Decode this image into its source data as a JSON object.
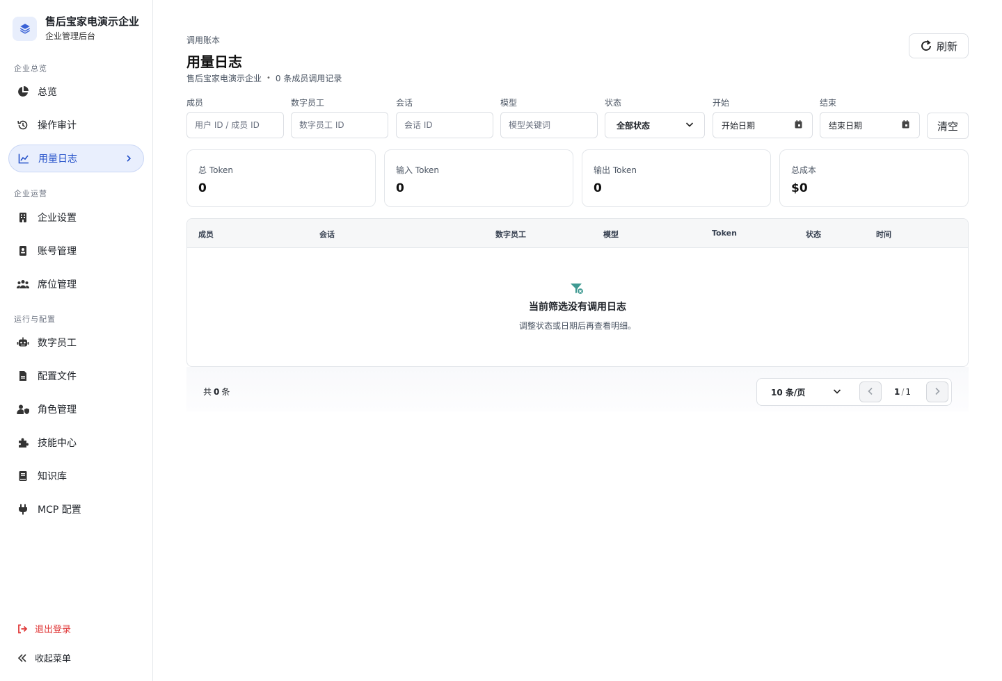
{
  "brand": {
    "name": "售后宝家电演示企业",
    "subtitle": "企业管理后台"
  },
  "sidebar": {
    "groups": [
      {
        "title": "企业总览"
      },
      {
        "title": "企业运营"
      },
      {
        "title": "运行与配置"
      }
    ],
    "items": [
      {
        "label": "总览",
        "icon": "pie-chart-icon"
      },
      {
        "label": "操作审计",
        "icon": "history-icon"
      },
      {
        "label": "用量日志",
        "icon": "line-chart-icon",
        "active": true
      },
      {
        "label": "企业设置",
        "icon": "building-icon"
      },
      {
        "label": "账号管理",
        "icon": "id-card-icon"
      },
      {
        "label": "席位管理",
        "icon": "users-icon"
      },
      {
        "label": "数字员工",
        "icon": "robot-icon"
      },
      {
        "label": "配置文件",
        "icon": "file-icon"
      },
      {
        "label": "角色管理",
        "icon": "user-shield-icon"
      },
      {
        "label": "技能中心",
        "icon": "puzzle-icon"
      },
      {
        "label": "知识库",
        "icon": "book-icon"
      },
      {
        "label": "MCP 配置",
        "icon": "plug-icon"
      }
    ],
    "logout": "退出登录",
    "collapse": "收起菜单"
  },
  "header": {
    "breadcrumb": "调用账本",
    "title": "用量日志",
    "org": "售后宝家电演示企业",
    "dot": "•",
    "summary": "0 条成员调用记录",
    "refresh_label": "刷新"
  },
  "filters": {
    "member": {
      "label": "成员",
      "placeholder": "用户 ID / 成员 ID"
    },
    "employee": {
      "label": "数字员工",
      "placeholder": "数字员工 ID"
    },
    "session": {
      "label": "会话",
      "placeholder": "会话 ID"
    },
    "model": {
      "label": "模型",
      "placeholder": "模型关键词"
    },
    "status": {
      "label": "状态",
      "value": "全部状态"
    },
    "start": {
      "label": "开始",
      "value": "开始日期"
    },
    "end": {
      "label": "结束",
      "value": "结束日期"
    },
    "clear_label": "清空"
  },
  "stats": [
    {
      "label": "总 Token",
      "value": "0"
    },
    {
      "label": "输入 Token",
      "value": "0"
    },
    {
      "label": "输出 Token",
      "value": "0"
    },
    {
      "label": "总成本",
      "value": "$0"
    }
  ],
  "table": {
    "columns": [
      "成员",
      "会话",
      "数字员工",
      "模型",
      "Token",
      "状态",
      "时间"
    ],
    "rows": [],
    "empty_title": "当前筛选没有调用日志",
    "empty_desc": "调整状态或日期后再查看明细。"
  },
  "pagination": {
    "total_prefix": "共",
    "total_count": "0",
    "total_suffix": "条",
    "page_size": "10 条/页",
    "current_page": "1",
    "separator": "/",
    "total_pages": "1"
  },
  "colors": {
    "accent": "#2350c9",
    "active_bg": "#e9effd",
    "danger": "#e03a3a",
    "empty_icon": "#3f9a92"
  }
}
